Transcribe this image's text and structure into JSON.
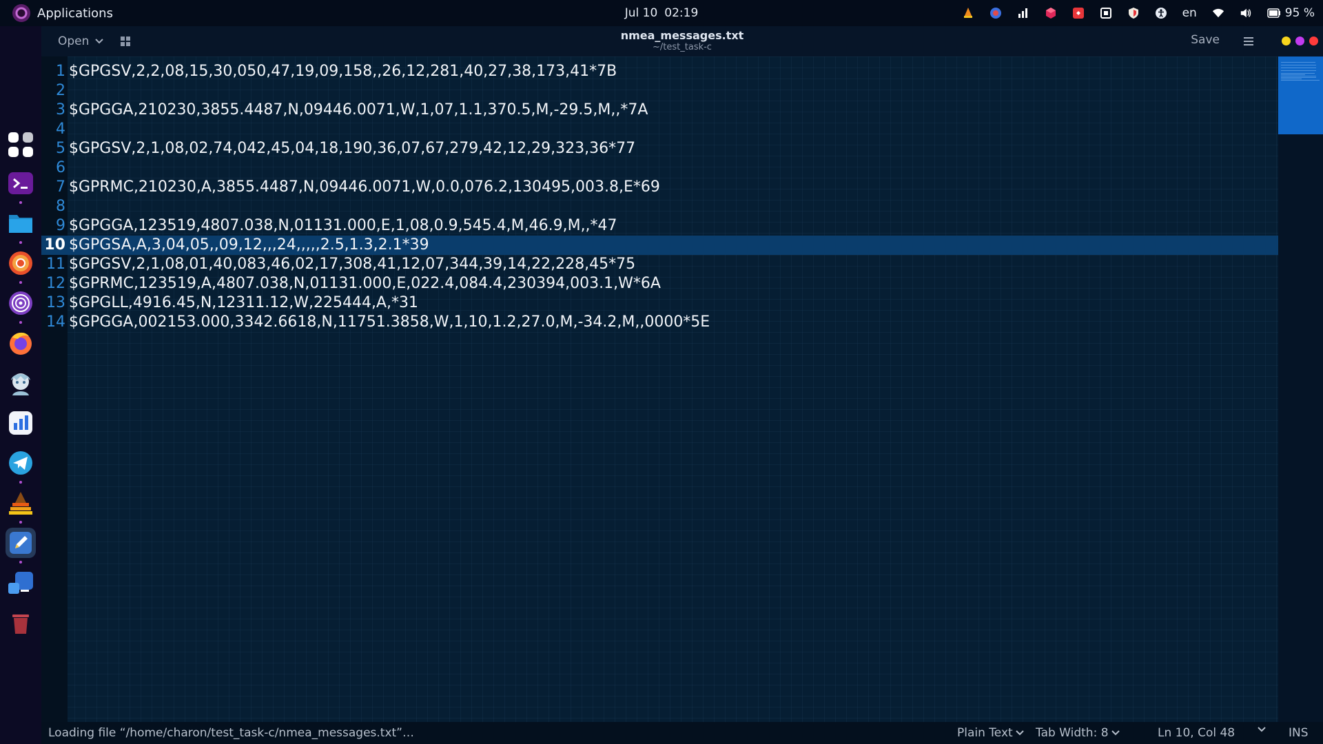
{
  "topbar": {
    "apps_label": "Applications",
    "date": "Jul 10",
    "time": "02:19",
    "keyboard_layout": "en",
    "battery": "95 %"
  },
  "dock": {
    "items": [
      "apps-grid",
      "terminal",
      "files",
      "chrome",
      "tor-browser",
      "firefox",
      "anime-avatar-app",
      "stats-app",
      "telegram",
      "vlc-style-app",
      "text-editor",
      "remote-desktop",
      "trash"
    ]
  },
  "editor": {
    "open_label": "Open",
    "title": "nmea_messages.txt",
    "subtitle": "~/test_task-c",
    "save_label": "Save",
    "window_colors": {
      "minimize": "#f7d51d",
      "maximize": "#c23bf0",
      "close": "#ff3b3b"
    },
    "current_line": 10,
    "lines": [
      {
        "n": "1",
        "text": "$GPGSV,2,2,08,15,30,050,47,19,09,158,,26,12,281,40,27,38,173,41*7B"
      },
      {
        "n": "2",
        "text": ""
      },
      {
        "n": "3",
        "text": "$GPGGA,210230,3855.4487,N,09446.0071,W,1,07,1.1,370.5,M,-29.5,M,,*7A"
      },
      {
        "n": "4",
        "text": ""
      },
      {
        "n": "5",
        "text": "$GPGSV,2,1,08,02,74,042,45,04,18,190,36,07,67,279,42,12,29,323,36*77"
      },
      {
        "n": "6",
        "text": ""
      },
      {
        "n": "7",
        "text": "$GPRMC,210230,A,3855.4487,N,09446.0071,W,0.0,076.2,130495,003.8,E*69"
      },
      {
        "n": "8",
        "text": ""
      },
      {
        "n": "9",
        "text": "$GPGGA,123519,4807.038,N,01131.000,E,1,08,0.9,545.4,M,46.9,M,,*47"
      },
      {
        "n": "10",
        "text": "$GPGSA,A,3,04,05,,09,12,,,24,,,,,2.5,1.3,2.1*39"
      },
      {
        "n": "11",
        "text": "$GPGSV,2,1,08,01,40,083,46,02,17,308,41,12,07,344,39,14,22,228,45*75"
      },
      {
        "n": "12",
        "text": "$GPRMC,123519,A,4807.038,N,01131.000,E,022.4,084.4,230394,003.1,W*6A"
      },
      {
        "n": "13",
        "text": "$GPGLL,4916.45,N,12311.12,W,225444,A,*31"
      },
      {
        "n": "14",
        "text": "$GPGGA,002153.000,3342.6618,N,11751.3858,W,1,10,1.2,27.0,M,-34.2,M,,0000*5E"
      }
    ]
  },
  "statusbar": {
    "message": "Loading file “/home/charon/test_task-c/nmea_messages.txt”…",
    "language": "Plain Text",
    "tab_width": "Tab Width: 8",
    "cursor_position": "Ln 10, Col 48",
    "mode": "INS"
  }
}
